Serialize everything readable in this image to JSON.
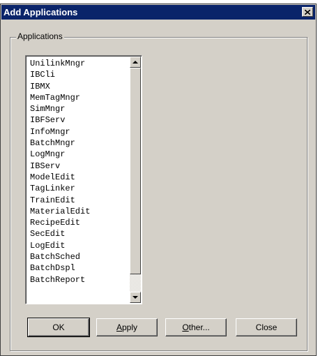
{
  "window": {
    "title": "Add Applications"
  },
  "group": {
    "label": "Applications"
  },
  "applications": [
    "UnilinkMngr",
    "IBCli",
    "IBMX",
    "MemTagMngr",
    "SimMngr",
    "IBFServ",
    "InfoMngr",
    "BatchMngr",
    "LogMngr",
    "IBServ",
    "ModelEdit",
    "TagLinker",
    "TrainEdit",
    "MaterialEdit",
    "RecipeEdit",
    "SecEdit",
    "LogEdit",
    "BatchSched",
    "BatchDspl",
    "BatchReport"
  ],
  "buttons": {
    "ok": "OK",
    "apply_first": "A",
    "apply_rest": "pply",
    "other_first": "O",
    "other_rest": "ther...",
    "close": "Close"
  },
  "icons": {
    "title_close": "close-icon",
    "scroll_up": "arrow-up-icon",
    "scroll_down": "arrow-down-icon"
  }
}
